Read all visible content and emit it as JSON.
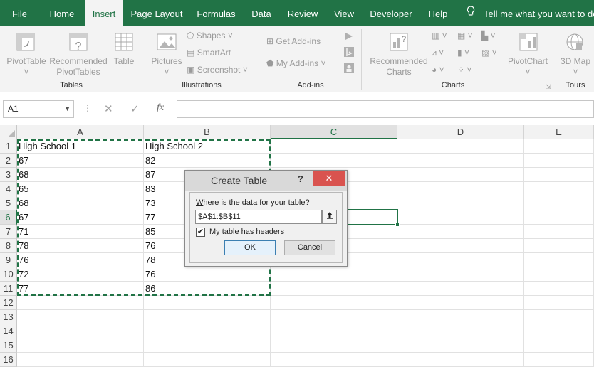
{
  "tabs": [
    {
      "label": "File"
    },
    {
      "label": "Home"
    },
    {
      "label": "Insert"
    },
    {
      "label": "Page Layout"
    },
    {
      "label": "Formulas"
    },
    {
      "label": "Data"
    },
    {
      "label": "Review"
    },
    {
      "label": "View"
    },
    {
      "label": "Developer"
    },
    {
      "label": "Help"
    }
  ],
  "tell_me": "Tell me what you want to do",
  "ribbon": {
    "tables": {
      "pivottable": "PivotTable",
      "recommended_pivottables": "Recommended PivotTables",
      "table": "Table",
      "group": "Tables"
    },
    "illustrations": {
      "pictures": "Pictures",
      "shapes": "Shapes",
      "smartart": "SmartArt",
      "screenshot": "Screenshot",
      "group": "Illustrations"
    },
    "addins": {
      "get_addins": "Get Add-ins",
      "my_addins": "My Add-ins",
      "group": "Add-ins"
    },
    "charts": {
      "recommended_charts": "Recommended Charts",
      "pivotchart": "PivotChart",
      "group": "Charts"
    },
    "tours": {
      "map_3d": "3D Map",
      "group": "Tours"
    }
  },
  "name_box": "A1",
  "fx_label": "fx",
  "columns": [
    "A",
    "B",
    "C",
    "D",
    "E"
  ],
  "rows": [
    "1",
    "2",
    "3",
    "4",
    "5",
    "6",
    "7",
    "8",
    "9",
    "10",
    "11",
    "12",
    "13",
    "14",
    "15",
    "16"
  ],
  "cells": {
    "A": [
      "High School 1",
      "67",
      "68",
      "65",
      "68",
      "67",
      "71",
      "78",
      "76",
      "72",
      "77"
    ],
    "B": [
      "High School 2",
      "82",
      "87",
      "83",
      "73",
      "77",
      "85",
      "76",
      "78",
      "76",
      "86"
    ]
  },
  "dialog": {
    "title": "Create Table",
    "help": "?",
    "close": "✕",
    "question_underlined": "W",
    "question_rest": "here is the data for your table?",
    "range": "$A$1:$B$11",
    "headers_check": "✔",
    "headers_underlined": "M",
    "headers_rest": "y table has headers",
    "ok": "OK",
    "cancel": "Cancel"
  }
}
